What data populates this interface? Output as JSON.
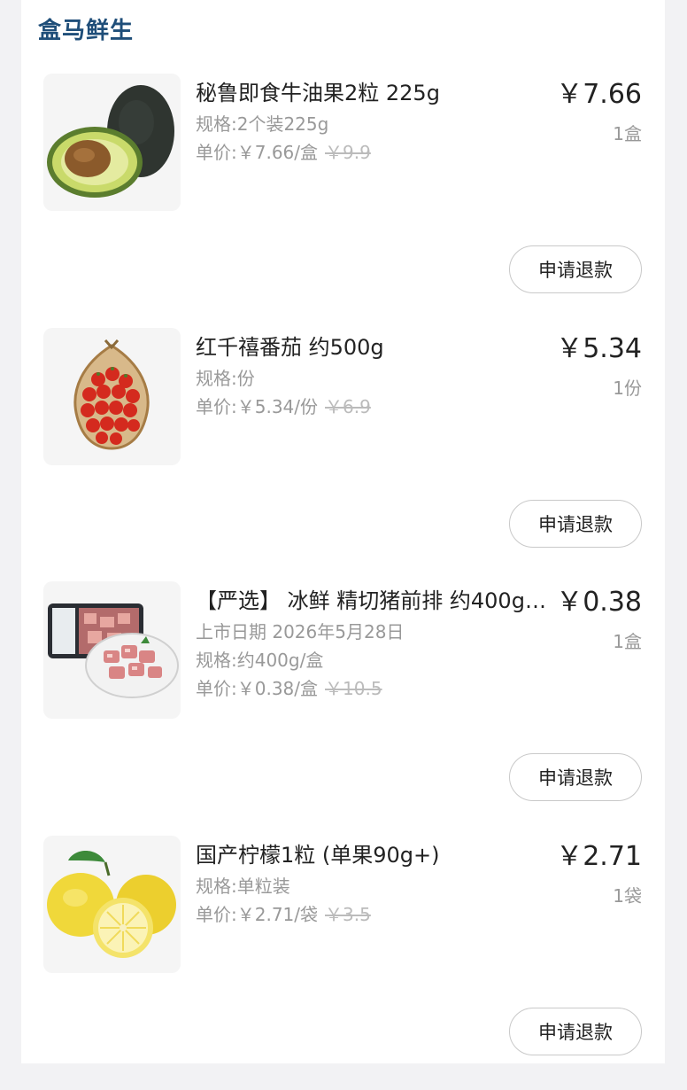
{
  "brand": "盒马鲜生",
  "items": [
    {
      "name": "秘鲁即食牛油果2粒 225g",
      "meta": [
        "规格:2个装225g"
      ],
      "unit_price": "单价:￥7.66/盒",
      "original_price": "￥9.9",
      "price": "￥7.66",
      "qty": "1盒",
      "refund_label": "申请退款",
      "image_icon": "avocado-icon"
    },
    {
      "name": "红千禧番茄 约500g",
      "meta": [
        "规格:份"
      ],
      "unit_price": "单价:￥5.34/份",
      "original_price": "￥6.9",
      "price": "￥5.34",
      "qty": "1份",
      "refund_label": "申请退款",
      "image_icon": "cherry-tomato-icon"
    },
    {
      "name": "【严选】 冰鲜 精切猪前排 约400g(…",
      "meta": [
        "上市日期 2026年5月28日",
        "规格:约400g/盒"
      ],
      "unit_price": "单价:￥0.38/盒",
      "original_price": "￥10.5",
      "price": "￥0.38",
      "qty": "1盒",
      "refund_label": "申请退款",
      "image_icon": "pork-ribs-icon"
    },
    {
      "name": "国产柠檬1粒 (单果90g+)",
      "meta": [
        "规格:单粒装"
      ],
      "unit_price": "单价:￥2.71/袋",
      "original_price": "￥3.5",
      "price": "￥2.71",
      "qty": "1袋",
      "refund_label": "申请退款",
      "image_icon": "lemon-icon"
    }
  ]
}
